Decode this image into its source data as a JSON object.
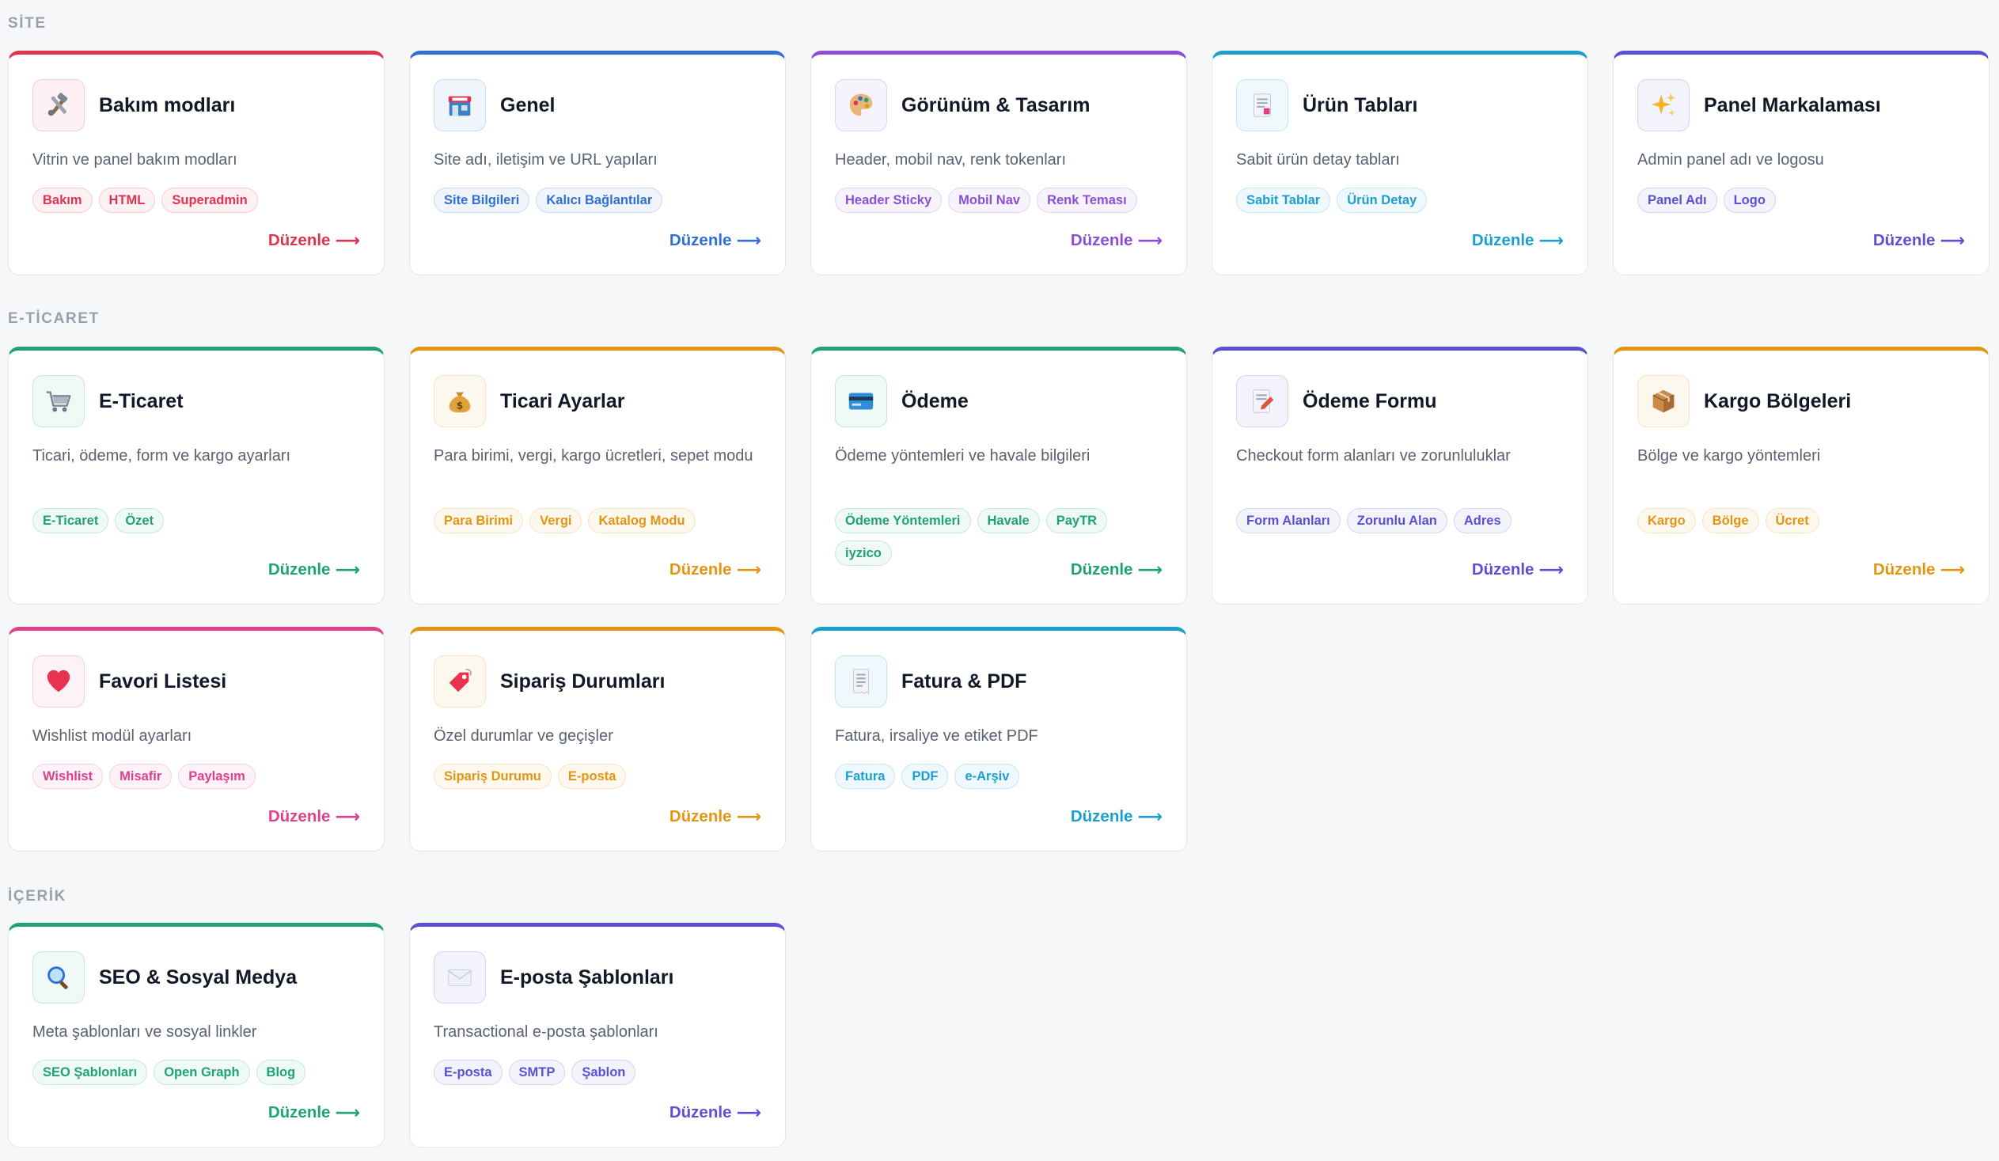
{
  "sections": {
    "site": "SİTE",
    "ecommerce": "E-TİCARET",
    "content": "İÇERİK"
  },
  "edit_label": "Düzenle",
  "edit_arrow": "⟶",
  "cards": [
    {
      "title": "Bakım modları",
      "desc": "Vitrin ve panel bakım modları",
      "tags": [
        "Bakım",
        "HTML",
        "Superadmin"
      ],
      "icon": "tools-icon",
      "accent": "#e0334f"
    },
    {
      "title": "Genel",
      "desc": "Site adı, iletişim ve URL yapıları",
      "tags": [
        "Site Bilgileri",
        "Kalıcı Bağlantılar"
      ],
      "icon": "storefront-icon",
      "accent": "#2f6fd6"
    },
    {
      "title": "Görünüm & Tasarım",
      "desc": "Header, mobil nav, renk tokenları",
      "tags": [
        "Header Sticky",
        "Mobil Nav",
        "Renk Teması"
      ],
      "icon": "palette-icon",
      "accent": "#8b4fd6"
    },
    {
      "title": "Ürün Tabları",
      "desc": "Sabit ürün detay tabları",
      "tags": [
        "Sabit Tablar",
        "Ürün Detay"
      ],
      "icon": "page-icon",
      "accent": "#1a9fcf"
    },
    {
      "title": "Panel Markalaması",
      "desc": "Admin panel adı ve logosu",
      "tags": [
        "Panel Adı",
        "Logo"
      ],
      "icon": "sparkles-icon",
      "accent": "#5b4fd6"
    },
    {
      "title": "E-Ticaret",
      "desc": "Ticari, ödeme, form ve kargo ayarları",
      "tags": [
        "E-Ticaret",
        "Özet"
      ],
      "icon": "cart-icon",
      "accent": "#1fa373"
    },
    {
      "title": "Ticari Ayarlar",
      "desc": "Para birimi, vergi, kargo ücretleri, sepet modu",
      "tags": [
        "Para Birimi",
        "Vergi",
        "Katalog Modu"
      ],
      "icon": "money-bag-icon",
      "accent": "#e39512"
    },
    {
      "title": "Ödeme",
      "desc": "Ödeme yöntemleri ve havale bilgileri",
      "tags": [
        "Ödeme Yöntemleri",
        "Havale",
        "PayTR",
        "iyzico"
      ],
      "icon": "credit-card-icon",
      "accent": "#1fa373"
    },
    {
      "title": "Ödeme Formu",
      "desc": "Checkout form alanları ve zorunluluklar",
      "tags": [
        "Form Alanları",
        "Zorunlu Alan",
        "Adres"
      ],
      "icon": "memo-icon",
      "accent": "#5b4fd6"
    },
    {
      "title": "Kargo Bölgeleri",
      "desc": "Bölge ve kargo yöntemleri",
      "tags": [
        "Kargo",
        "Bölge",
        "Ücret"
      ],
      "icon": "package-icon",
      "accent": "#e39512"
    },
    {
      "title": "Favori Listesi",
      "desc": "Wishlist modül ayarları",
      "tags": [
        "Wishlist",
        "Misafir",
        "Paylaşım"
      ],
      "icon": "heart-icon",
      "accent": "#e0408a"
    },
    {
      "title": "Sipariş Durumları",
      "desc": "Özel durumlar ve geçişler",
      "tags": [
        "Sipariş Durumu",
        "E-posta"
      ],
      "icon": "label-tag-icon",
      "accent": "#e39512"
    },
    {
      "title": "Fatura & PDF",
      "desc": "Fatura, irsaliye ve etiket PDF",
      "tags": [
        "Fatura",
        "PDF",
        "e-Arşiv"
      ],
      "icon": "receipt-icon",
      "accent": "#1a9fcf"
    },
    {
      "title": "SEO & Sosyal Medya",
      "desc": "Meta şablonları ve sosyal linkler",
      "tags": [
        "SEO Şablonları",
        "Open Graph",
        "Blog"
      ],
      "icon": "magnifier-icon",
      "accent": "#1fa373"
    },
    {
      "title": "E-posta Şablonları",
      "desc": "Transactional e-posta şablonları",
      "tags": [
        "E-posta",
        "SMTP",
        "Şablon"
      ],
      "icon": "envelope-icon",
      "accent": "#5b4fd6"
    }
  ]
}
